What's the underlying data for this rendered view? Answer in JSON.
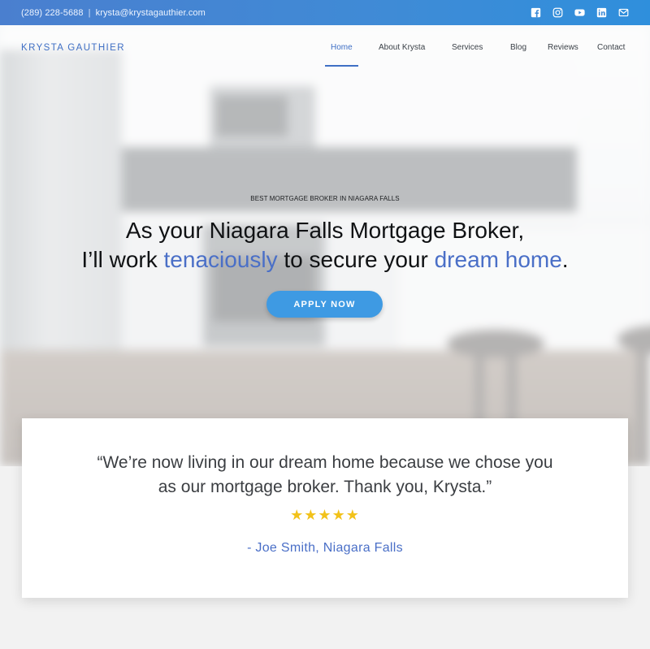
{
  "topbar": {
    "phone": "(289) 228-5688",
    "separator": "|",
    "email": "krysta@krystagauthier.com",
    "social_icons": [
      "facebook-icon",
      "instagram-icon",
      "youtube-icon",
      "linkedin-icon",
      "mail-icon"
    ]
  },
  "nav": {
    "logo": "KRYSTA GAUTHIER",
    "items": [
      {
        "label": "Home",
        "active": true
      },
      {
        "label": "About Krysta",
        "active": false
      },
      {
        "label": "Services",
        "active": false
      },
      {
        "label": "Blog",
        "active": false
      },
      {
        "label": "Reviews",
        "active": false
      },
      {
        "label": "Contact",
        "active": false
      }
    ]
  },
  "hero": {
    "eyebrow": "BEST MORTGAGE BROKER IN NIAGARA FALLS",
    "line1": "As your Niagara Falls Mortgage Broker,",
    "line2_part1": "I’ll work ",
    "line2_accent1": "tenaciously",
    "line2_part2": " to secure your ",
    "line2_accent2": "dream home",
    "line2_end": ".",
    "cta": "APPLY NOW"
  },
  "testimonial": {
    "quote_line1": "“We’re now living in our dream home because we chose you",
    "quote_line2": "as our mortgage broker. Thank you, Krysta.”",
    "stars": "★★★★★",
    "rating": 5,
    "author": "- Joe Smith, Niagara Falls"
  },
  "colors": {
    "accent": "#4a6fc7",
    "button": "#3e9ae3",
    "star": "#f2c21a"
  }
}
